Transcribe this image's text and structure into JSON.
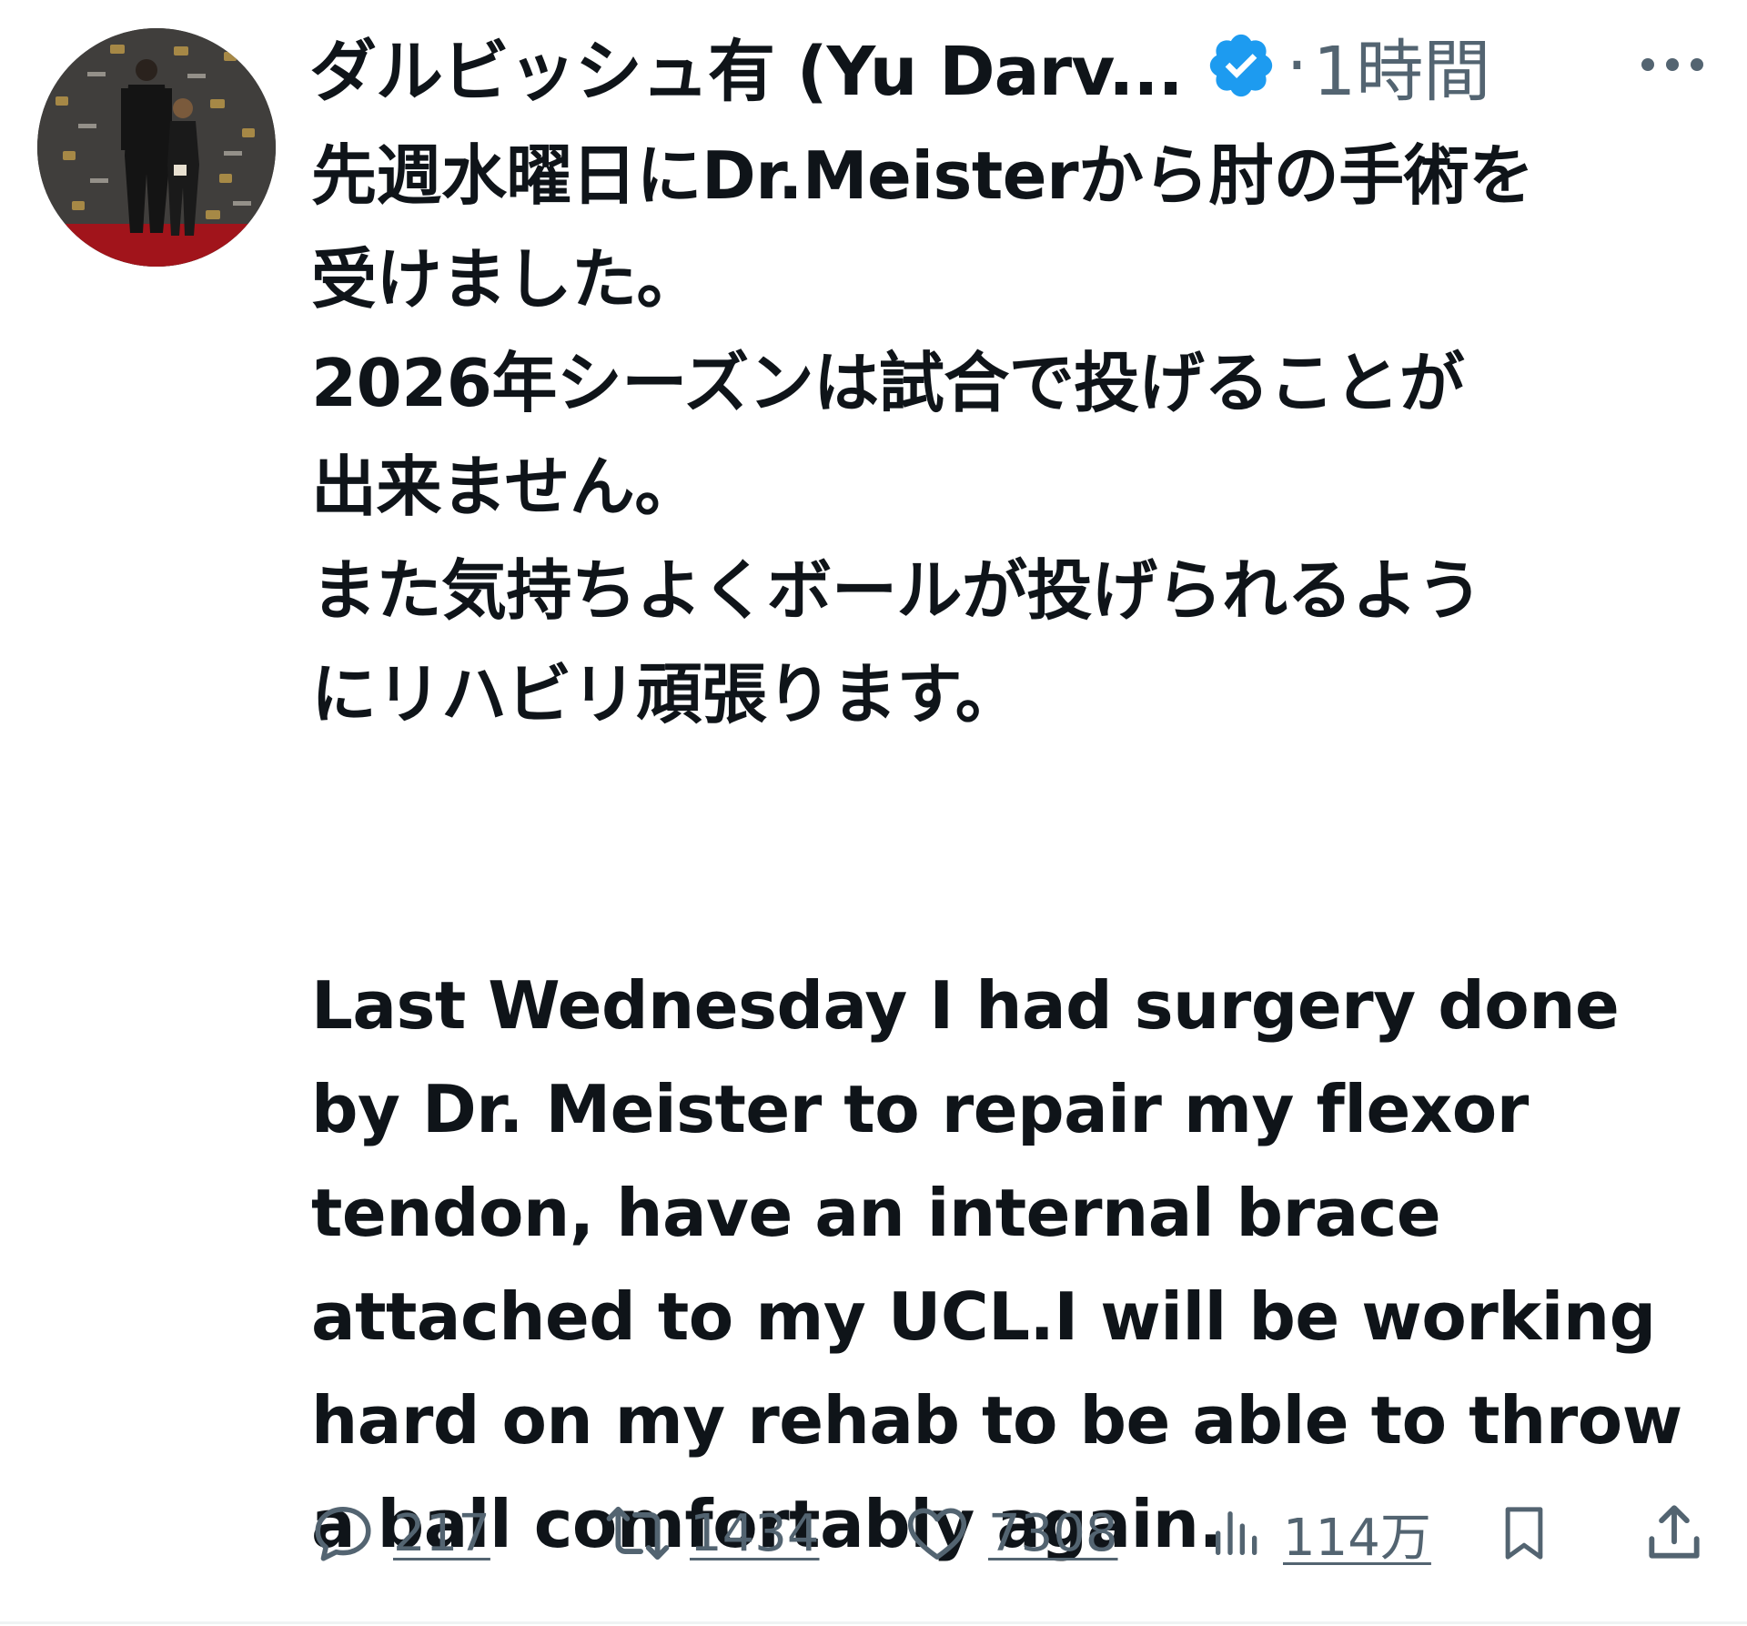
{
  "tweet": {
    "author": {
      "display_name": "ダルビッシュ有 (Yu Darv...",
      "verified_icon": "verified-badge-icon",
      "avatar": "profile-photo"
    },
    "separator": "·",
    "timestamp": "1時間",
    "more_icon": "more-options-icon",
    "body_lines_ja": [
      "先週水曜日にDr.Meisterから肘の手術を",
      "受けました。",
      "2026年シーズンは試合で投げることが",
      "出来ません。",
      "また気持ちよくボールが投げられるよう",
      "にリハビリ頑張ります。"
    ],
    "body_lines_en": [
      "Last Wednesday I had surgery done",
      "by Dr. Meister to repair my flexor",
      "tendon, have an internal brace",
      "attached to my UCL.I will be working",
      "hard on my rehab to be able to throw",
      "a ball comfortably again."
    ],
    "actions": {
      "reply_count": "217",
      "repost_count": "1434",
      "like_count": "7308",
      "views_count": "114万"
    }
  },
  "colors": {
    "text_primary": "#0f1419",
    "text_secondary": "#536471",
    "verified_blue": "#1d9bf0"
  }
}
